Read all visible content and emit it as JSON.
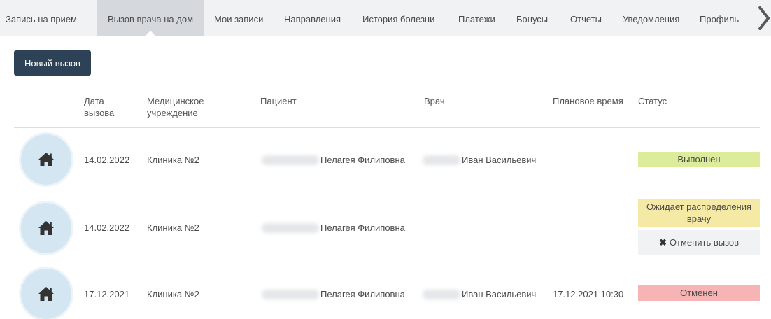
{
  "nav": {
    "items": [
      {
        "label": "Запись на прием"
      },
      {
        "label": "Вызов врача на дом"
      },
      {
        "label": "Мои записи"
      },
      {
        "label": "Направления"
      },
      {
        "label": "История болезни"
      },
      {
        "label": "Платежи"
      },
      {
        "label": "Бонусы"
      },
      {
        "label": "Отчеты"
      },
      {
        "label": "Уведомления"
      },
      {
        "label": "Профиль"
      }
    ],
    "active_index": 1,
    "next_icon": "chevron-right-icon"
  },
  "toolbar": {
    "new_call_label": "Новый вызов"
  },
  "table": {
    "headers": {
      "date": "Дата вызова",
      "clinic": "Медицинское учреждение",
      "patient": "Пациент",
      "doctor": "Врач",
      "planned_time": "Плановое время",
      "status": "Статус"
    },
    "rows": [
      {
        "icon": "home-icon",
        "date": "14.02.2022",
        "clinic": "Клиника №2",
        "patient": "Пелагея Филиповна",
        "doctor": "Иван Васильевич",
        "planned_time": "",
        "status": "Выполнен",
        "status_color": "#dcec9b"
      },
      {
        "icon": "home-icon",
        "date": "14.02.2022",
        "clinic": "Клиника №2",
        "patient": "Пелагея Филиповна",
        "doctor": "",
        "planned_time": "",
        "status": "Ожидает распределения врачу",
        "status_color": "#f5e9a6",
        "cancel_icon": "x-icon",
        "cancel_label": "Отменить вызов"
      },
      {
        "icon": "home-icon",
        "date": "17.12.2021",
        "clinic": "Клиника №2",
        "patient": "Пелагея Филиповна",
        "doctor": "Иван Васильевич",
        "planned_time": "17.12.2021 10:30",
        "status": "Отменен",
        "status_color": "#f6b4b4"
      }
    ]
  },
  "colors": {
    "nav_bg": "#f1f2f4",
    "nav_active": "#d5d9de",
    "primary_button": "#2d4256",
    "home_badge": "#d4e6f1"
  }
}
